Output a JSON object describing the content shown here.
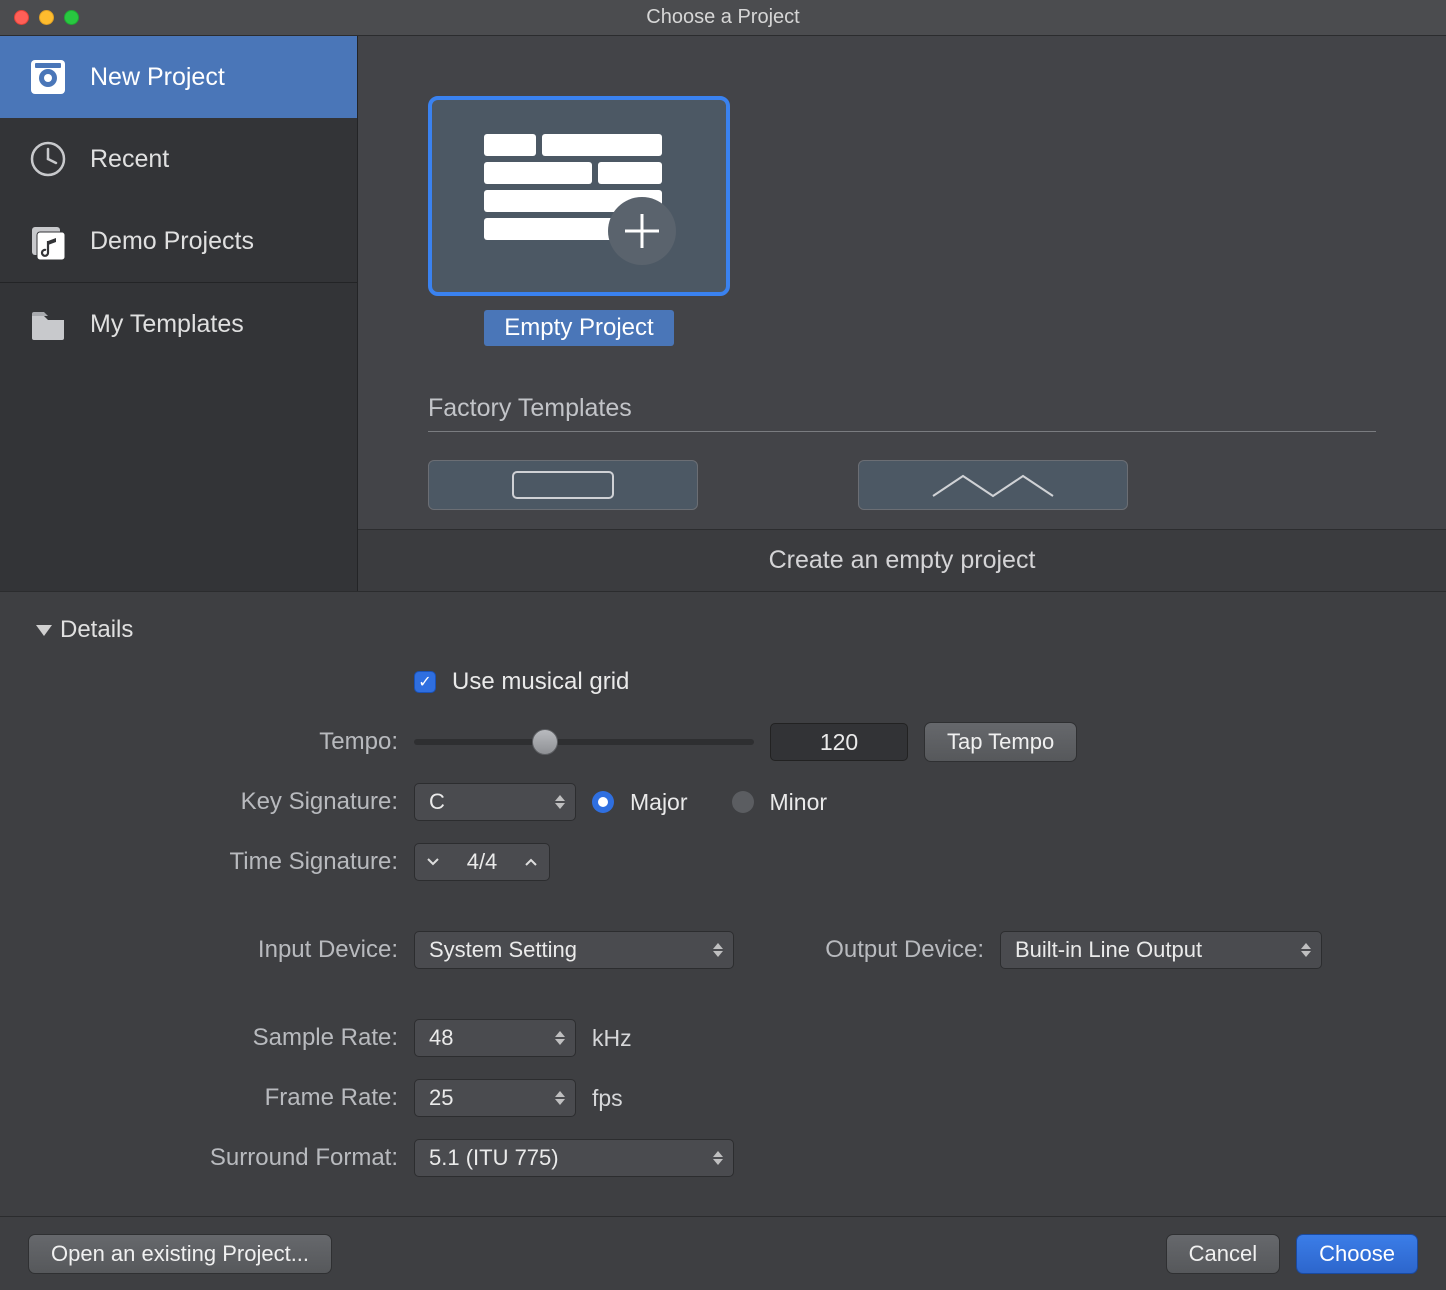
{
  "titlebar": {
    "title": "Choose a Project"
  },
  "sidebar": {
    "items": [
      {
        "label": "New Project"
      },
      {
        "label": "Recent"
      },
      {
        "label": "Demo Projects"
      },
      {
        "label": "My Templates"
      }
    ]
  },
  "templates": {
    "selected_label": "Empty Project",
    "factory_header": "Factory Templates",
    "description": "Create an empty project"
  },
  "details": {
    "header": "Details",
    "use_grid_label": "Use musical grid",
    "use_grid_checked": true,
    "tempo_label": "Tempo:",
    "tempo_value": "120",
    "tap_tempo_label": "Tap Tempo",
    "key_sig_label": "Key Signature:",
    "key_sig_value": "C",
    "major_label": "Major",
    "minor_label": "Minor",
    "time_sig_label": "Time Signature:",
    "time_sig_value": "4/4",
    "input_device_label": "Input Device:",
    "input_device_value": "System Setting",
    "output_device_label": "Output Device:",
    "output_device_value": "Built-in Line Output",
    "sample_rate_label": "Sample Rate:",
    "sample_rate_value": "48",
    "sample_rate_unit": "kHz",
    "frame_rate_label": "Frame Rate:",
    "frame_rate_value": "25",
    "frame_rate_unit": "fps",
    "surround_label": "Surround Format:",
    "surround_value": "5.1 (ITU 775)"
  },
  "footer": {
    "open_existing": "Open an existing Project...",
    "cancel": "Cancel",
    "choose": "Choose"
  }
}
